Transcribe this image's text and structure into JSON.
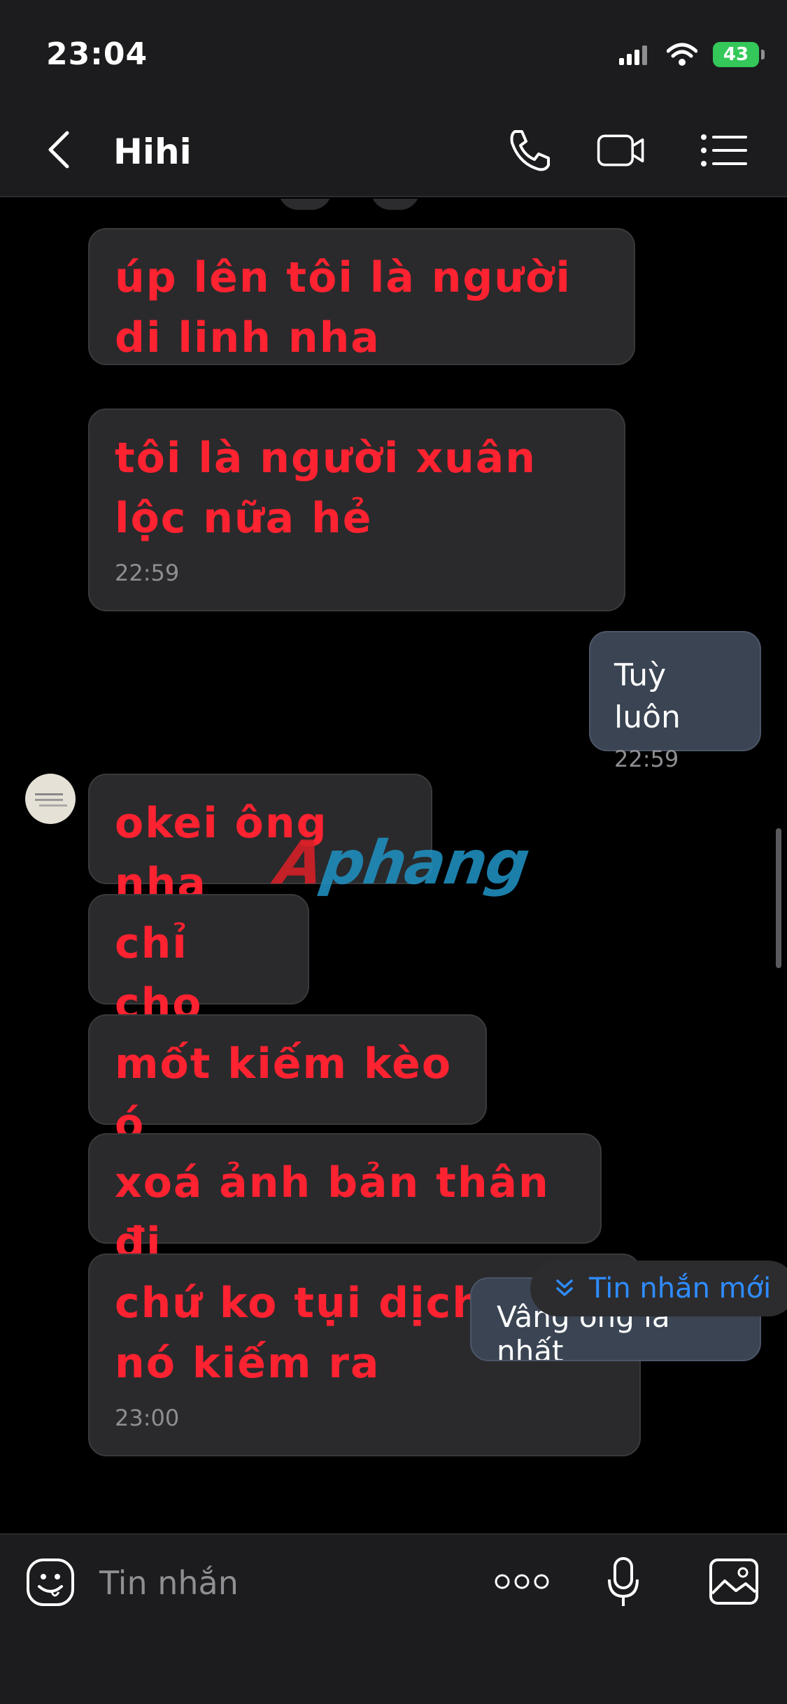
{
  "status_bar": {
    "time": "23:04",
    "battery": "43"
  },
  "header": {
    "title": "Hihi"
  },
  "messages": {
    "m1": "úp lên tôi là người di linh nha",
    "m2": "tôi là người xuân lộc nữa hẻ",
    "m2_time": "22:59",
    "m3": "Tuỳ luôn",
    "m3_time": "22:59",
    "m4": "okei ông nha",
    "m5": "chỉ cho",
    "m6": "mốt kiếm kèo ó",
    "m7": "xoá ảnh bản thân đi",
    "m8": "chứ ko tụi dịch vụ nó kiếm ra",
    "m8_time": "23:00",
    "m9_partial": "Vâng ông là nhất"
  },
  "new_messages_label": "Tin nhắn mới",
  "watermark": "Aphang",
  "input": {
    "placeholder": "Tin nhắn"
  },
  "colors": {
    "incoming_text": "#ff2230",
    "accent": "#2f8cff",
    "outgoing_bubble": "#3a4453"
  }
}
